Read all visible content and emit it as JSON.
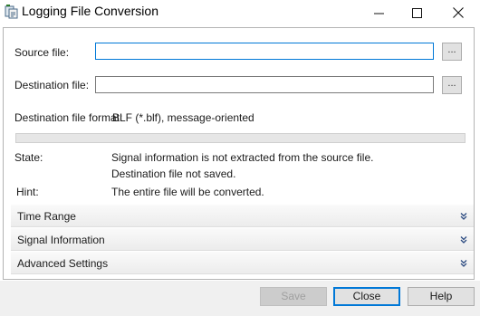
{
  "window": {
    "title": "Logging File Conversion",
    "icon": "app-icon",
    "minimize_icon": "minimize-icon",
    "maximize_icon": "maximize-icon",
    "close_icon": "close-icon"
  },
  "form": {
    "source_label": "Source file:",
    "source_value": "",
    "destination_label": "Destination file:",
    "destination_value": "",
    "browse_label": "...",
    "format_label": "Destination file format:",
    "format_value": "BLF (*.blf), message-oriented"
  },
  "progress": {
    "fraction": 0
  },
  "status": {
    "state_label": "State:",
    "state_line1": "Signal information is not extracted from the source file.",
    "state_line2": "Destination file not saved.",
    "hint_label": "Hint:",
    "hint_value": "The entire file will be converted."
  },
  "sections": [
    {
      "label": "Time Range",
      "icon": "chevron-double-down-icon"
    },
    {
      "label": "Signal Information",
      "icon": "chevron-double-down-icon"
    },
    {
      "label": "Advanced Settings",
      "icon": "chevron-double-down-icon"
    }
  ],
  "footer": {
    "save_label": "Save",
    "close_label": "Close",
    "help_label": "Help"
  },
  "colors": {
    "focus_border": "#0078d7",
    "footer_bg": "#f0f0f0"
  }
}
